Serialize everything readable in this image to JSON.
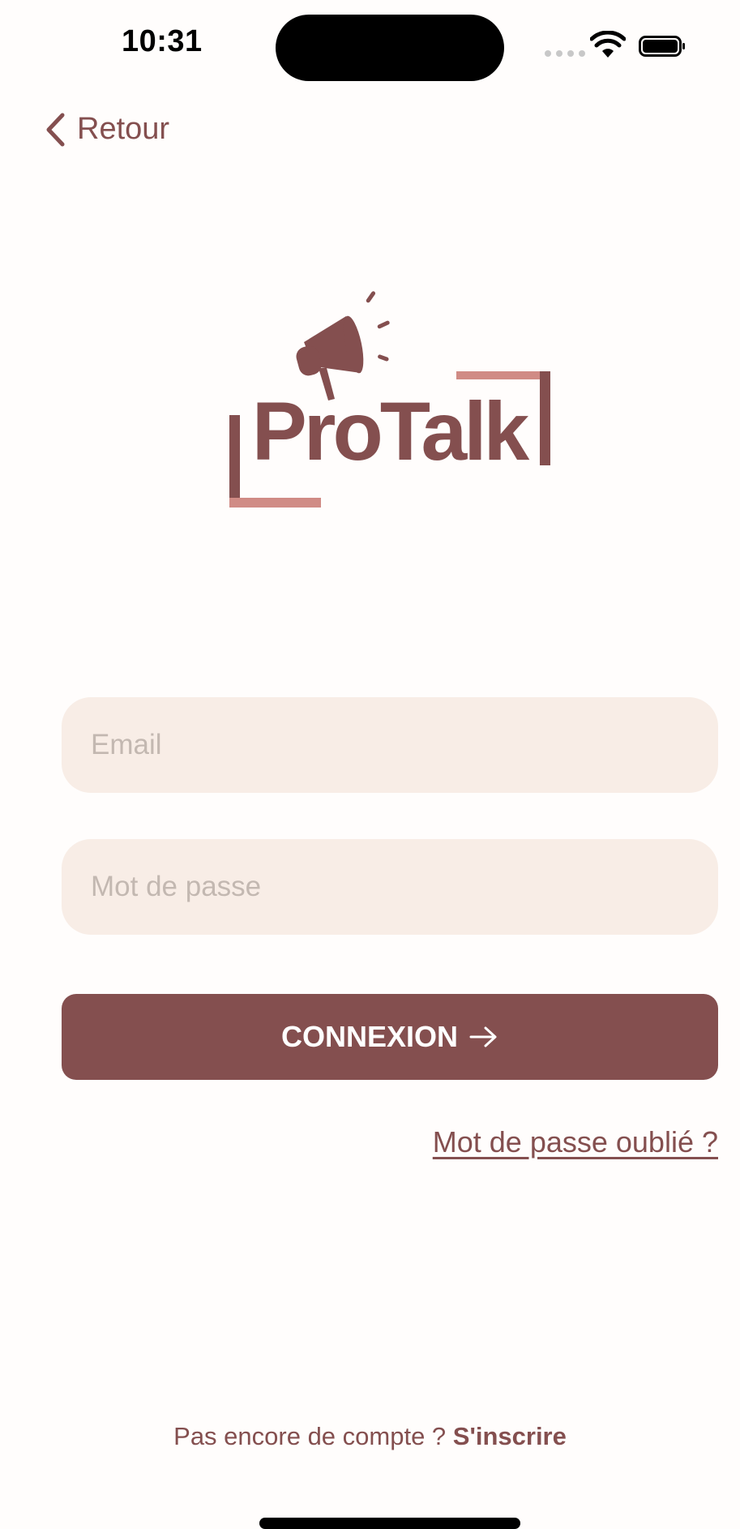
{
  "status_bar": {
    "time": "10:31"
  },
  "nav": {
    "back_label": "Retour"
  },
  "logo": {
    "text": "ProTalk"
  },
  "form": {
    "email_placeholder": "Email",
    "email_value": "",
    "password_placeholder": "Mot de passe",
    "password_value": "",
    "submit_label": "CONNEXION",
    "forgot_label": "Mot de passe oublié ?"
  },
  "footer": {
    "prompt": "Pas encore de compte ? ",
    "signup_label": "S'inscrire"
  },
  "icons": {
    "back": "chevron-left-icon",
    "submit": "arrow-right-icon",
    "logo": "megaphone-icon",
    "wifi": "wifi-icon",
    "battery": "battery-icon"
  },
  "colors": {
    "brand": "#844f4f",
    "brand_light": "#d08b85",
    "field_bg": "#f8ede6",
    "background": "#fffdfc"
  }
}
